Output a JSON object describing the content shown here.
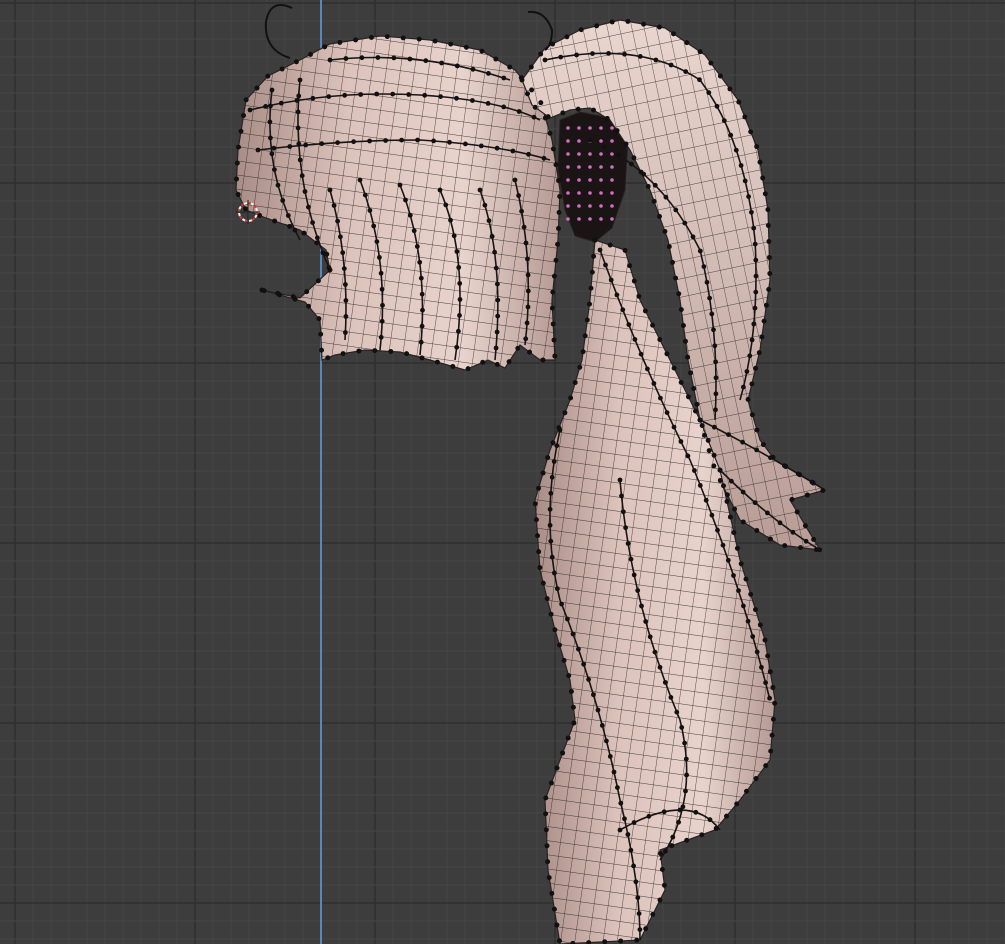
{
  "viewport": {
    "mode": "edit-mode",
    "view": "side-orthographic",
    "colors": {
      "background": "#3d3d3d",
      "grid_minor": "#454545",
      "grid_major": "#2f2f2f",
      "axis_line": "#5a86b8",
      "mesh_fill": "#d7bdb5",
      "mesh_shadow": "#9a807a",
      "wire": "#2a2222",
      "vertex": "#111111",
      "selected_vertex": "#d070c0",
      "cursor_ring": "#d03a3a",
      "cursor_cross": "#f0f0f0"
    },
    "objects": [
      {
        "name": "hair-bangs-mesh"
      },
      {
        "name": "hair-ponytail-mesh"
      },
      {
        "name": "hair-tie-mesh"
      }
    ]
  }
}
